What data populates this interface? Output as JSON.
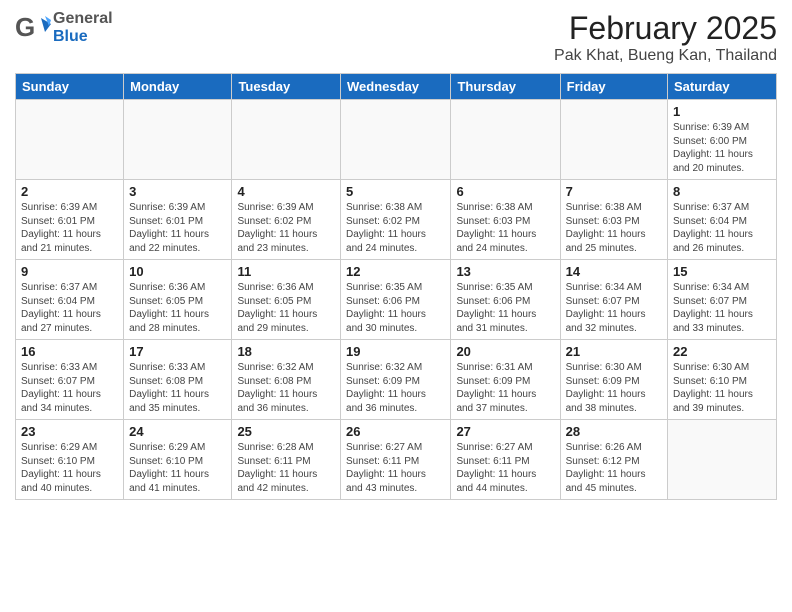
{
  "header": {
    "logo_general": "General",
    "logo_blue": "Blue",
    "main_title": "February 2025",
    "subtitle": "Pak Khat, Bueng Kan, Thailand"
  },
  "days_of_week": [
    "Sunday",
    "Monday",
    "Tuesday",
    "Wednesday",
    "Thursday",
    "Friday",
    "Saturday"
  ],
  "weeks": [
    [
      {
        "day": "",
        "info": ""
      },
      {
        "day": "",
        "info": ""
      },
      {
        "day": "",
        "info": ""
      },
      {
        "day": "",
        "info": ""
      },
      {
        "day": "",
        "info": ""
      },
      {
        "day": "",
        "info": ""
      },
      {
        "day": "1",
        "info": "Sunrise: 6:39 AM\nSunset: 6:00 PM\nDaylight: 11 hours\nand 20 minutes."
      }
    ],
    [
      {
        "day": "2",
        "info": "Sunrise: 6:39 AM\nSunset: 6:01 PM\nDaylight: 11 hours\nand 21 minutes."
      },
      {
        "day": "3",
        "info": "Sunrise: 6:39 AM\nSunset: 6:01 PM\nDaylight: 11 hours\nand 22 minutes."
      },
      {
        "day": "4",
        "info": "Sunrise: 6:39 AM\nSunset: 6:02 PM\nDaylight: 11 hours\nand 23 minutes."
      },
      {
        "day": "5",
        "info": "Sunrise: 6:38 AM\nSunset: 6:02 PM\nDaylight: 11 hours\nand 24 minutes."
      },
      {
        "day": "6",
        "info": "Sunrise: 6:38 AM\nSunset: 6:03 PM\nDaylight: 11 hours\nand 24 minutes."
      },
      {
        "day": "7",
        "info": "Sunrise: 6:38 AM\nSunset: 6:03 PM\nDaylight: 11 hours\nand 25 minutes."
      },
      {
        "day": "8",
        "info": "Sunrise: 6:37 AM\nSunset: 6:04 PM\nDaylight: 11 hours\nand 26 minutes."
      }
    ],
    [
      {
        "day": "9",
        "info": "Sunrise: 6:37 AM\nSunset: 6:04 PM\nDaylight: 11 hours\nand 27 minutes."
      },
      {
        "day": "10",
        "info": "Sunrise: 6:36 AM\nSunset: 6:05 PM\nDaylight: 11 hours\nand 28 minutes."
      },
      {
        "day": "11",
        "info": "Sunrise: 6:36 AM\nSunset: 6:05 PM\nDaylight: 11 hours\nand 29 minutes."
      },
      {
        "day": "12",
        "info": "Sunrise: 6:35 AM\nSunset: 6:06 PM\nDaylight: 11 hours\nand 30 minutes."
      },
      {
        "day": "13",
        "info": "Sunrise: 6:35 AM\nSunset: 6:06 PM\nDaylight: 11 hours\nand 31 minutes."
      },
      {
        "day": "14",
        "info": "Sunrise: 6:34 AM\nSunset: 6:07 PM\nDaylight: 11 hours\nand 32 minutes."
      },
      {
        "day": "15",
        "info": "Sunrise: 6:34 AM\nSunset: 6:07 PM\nDaylight: 11 hours\nand 33 minutes."
      }
    ],
    [
      {
        "day": "16",
        "info": "Sunrise: 6:33 AM\nSunset: 6:07 PM\nDaylight: 11 hours\nand 34 minutes."
      },
      {
        "day": "17",
        "info": "Sunrise: 6:33 AM\nSunset: 6:08 PM\nDaylight: 11 hours\nand 35 minutes."
      },
      {
        "day": "18",
        "info": "Sunrise: 6:32 AM\nSunset: 6:08 PM\nDaylight: 11 hours\nand 36 minutes."
      },
      {
        "day": "19",
        "info": "Sunrise: 6:32 AM\nSunset: 6:09 PM\nDaylight: 11 hours\nand 36 minutes."
      },
      {
        "day": "20",
        "info": "Sunrise: 6:31 AM\nSunset: 6:09 PM\nDaylight: 11 hours\nand 37 minutes."
      },
      {
        "day": "21",
        "info": "Sunrise: 6:30 AM\nSunset: 6:09 PM\nDaylight: 11 hours\nand 38 minutes."
      },
      {
        "day": "22",
        "info": "Sunrise: 6:30 AM\nSunset: 6:10 PM\nDaylight: 11 hours\nand 39 minutes."
      }
    ],
    [
      {
        "day": "23",
        "info": "Sunrise: 6:29 AM\nSunset: 6:10 PM\nDaylight: 11 hours\nand 40 minutes."
      },
      {
        "day": "24",
        "info": "Sunrise: 6:29 AM\nSunset: 6:10 PM\nDaylight: 11 hours\nand 41 minutes."
      },
      {
        "day": "25",
        "info": "Sunrise: 6:28 AM\nSunset: 6:11 PM\nDaylight: 11 hours\nand 42 minutes."
      },
      {
        "day": "26",
        "info": "Sunrise: 6:27 AM\nSunset: 6:11 PM\nDaylight: 11 hours\nand 43 minutes."
      },
      {
        "day": "27",
        "info": "Sunrise: 6:27 AM\nSunset: 6:11 PM\nDaylight: 11 hours\nand 44 minutes."
      },
      {
        "day": "28",
        "info": "Sunrise: 6:26 AM\nSunset: 6:12 PM\nDaylight: 11 hours\nand 45 minutes."
      },
      {
        "day": "",
        "info": ""
      }
    ]
  ]
}
